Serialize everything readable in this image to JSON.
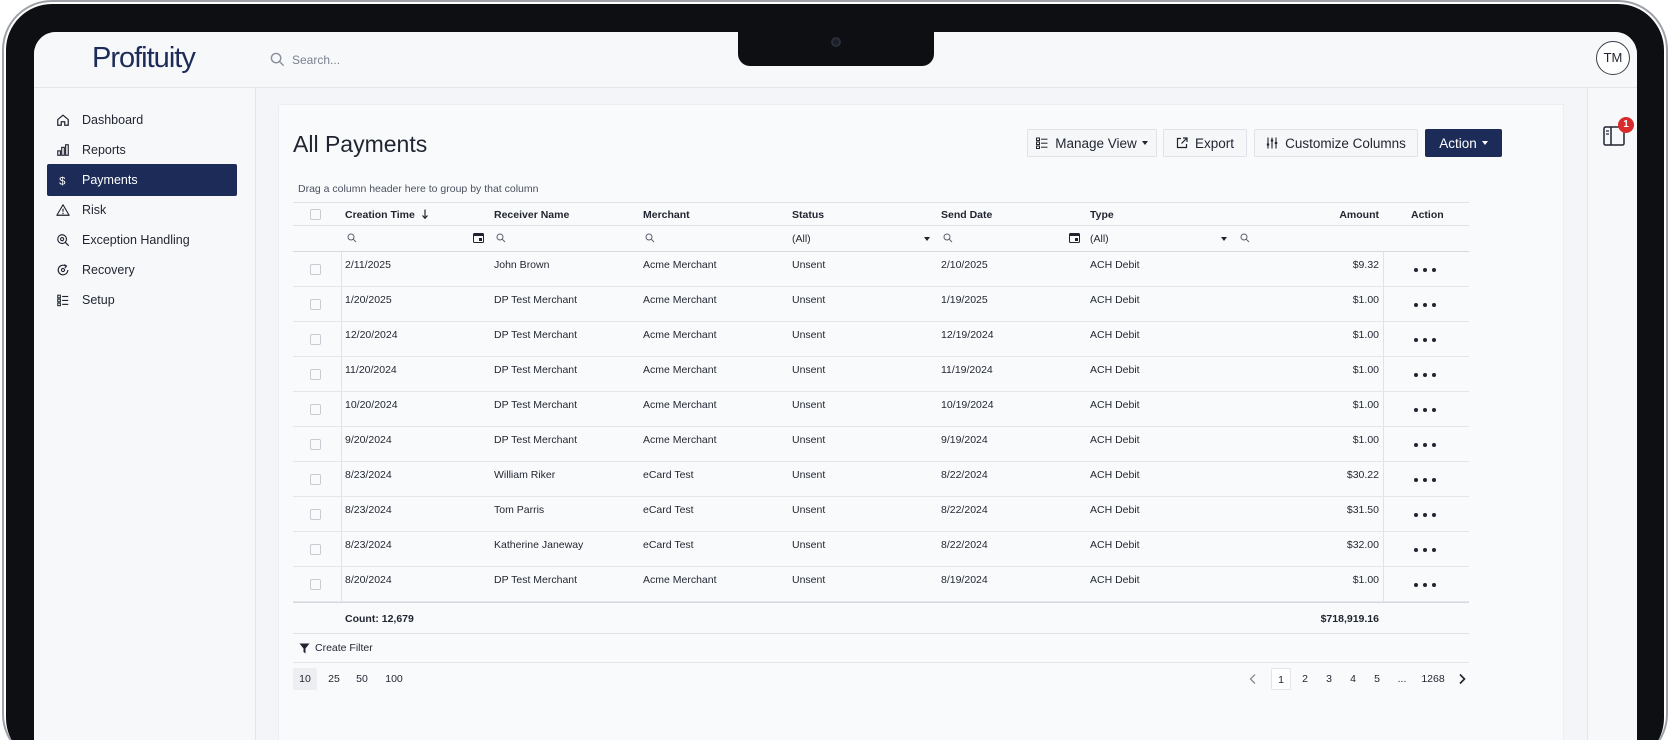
{
  "app": {
    "logo": "Profituity"
  },
  "search": {
    "placeholder": "Search..."
  },
  "user": {
    "initials": "TM"
  },
  "notifications": {
    "count": "1"
  },
  "colors": {
    "brand": "#1d2b59",
    "badge": "#d92b2b"
  },
  "sidebar": {
    "items": [
      {
        "label": "Dashboard",
        "icon": "home-icon",
        "active": false
      },
      {
        "label": "Reports",
        "icon": "bar-chart-icon",
        "active": false
      },
      {
        "label": "Payments",
        "icon": "dollar-icon",
        "active": true
      },
      {
        "label": "Risk",
        "icon": "warning-icon",
        "active": false
      },
      {
        "label": "Exception Handling",
        "icon": "search-gear-icon",
        "active": false
      },
      {
        "label": "Recovery",
        "icon": "recovery-icon",
        "active": false
      },
      {
        "label": "Setup",
        "icon": "list-settings-icon",
        "active": false
      }
    ]
  },
  "page": {
    "title": "All Payments",
    "group_hint": "Drag a column header here to group by that column"
  },
  "toolbar": {
    "manage_view": "Manage View",
    "export": "Export",
    "customize_columns": "Customize Columns",
    "action": "Action"
  },
  "grid": {
    "columns": {
      "creation_time": "Creation Time",
      "receiver_name": "Receiver Name",
      "merchant": "Merchant",
      "status": "Status",
      "send_date": "Send Date",
      "type": "Type",
      "amount": "Amount",
      "action": "Action"
    },
    "filters": {
      "status": "(All)",
      "type": "(All)"
    },
    "rows": [
      {
        "creation_time": "2/11/2025",
        "receiver_name": "John Brown",
        "merchant": "Acme Merchant",
        "status": "Unsent",
        "send_date": "2/10/2025",
        "type": "ACH Debit",
        "amount": "$9.32"
      },
      {
        "creation_time": "1/20/2025",
        "receiver_name": "DP Test Merchant",
        "merchant": "Acme Merchant",
        "status": "Unsent",
        "send_date": "1/19/2025",
        "type": "ACH Debit",
        "amount": "$1.00"
      },
      {
        "creation_time": "12/20/2024",
        "receiver_name": "DP Test Merchant",
        "merchant": "Acme Merchant",
        "status": "Unsent",
        "send_date": "12/19/2024",
        "type": "ACH Debit",
        "amount": "$1.00"
      },
      {
        "creation_time": "11/20/2024",
        "receiver_name": "DP Test Merchant",
        "merchant": "Acme Merchant",
        "status": "Unsent",
        "send_date": "11/19/2024",
        "type": "ACH Debit",
        "amount": "$1.00"
      },
      {
        "creation_time": "10/20/2024",
        "receiver_name": "DP Test Merchant",
        "merchant": "Acme Merchant",
        "status": "Unsent",
        "send_date": "10/19/2024",
        "type": "ACH Debit",
        "amount": "$1.00"
      },
      {
        "creation_time": "9/20/2024",
        "receiver_name": "DP Test Merchant",
        "merchant": "Acme Merchant",
        "status": "Unsent",
        "send_date": "9/19/2024",
        "type": "ACH Debit",
        "amount": "$1.00"
      },
      {
        "creation_time": "8/23/2024",
        "receiver_name": "William Riker",
        "merchant": "eCard Test",
        "status": "Unsent",
        "send_date": "8/22/2024",
        "type": "ACH Debit",
        "amount": "$30.22"
      },
      {
        "creation_time": "8/23/2024",
        "receiver_name": "Tom Parris",
        "merchant": "eCard Test",
        "status": "Unsent",
        "send_date": "8/22/2024",
        "type": "ACH Debit",
        "amount": "$31.50"
      },
      {
        "creation_time": "8/23/2024",
        "receiver_name": "Katherine Janeway",
        "merchant": "eCard Test",
        "status": "Unsent",
        "send_date": "8/22/2024",
        "type": "ACH Debit",
        "amount": "$32.00"
      },
      {
        "creation_time": "8/20/2024",
        "receiver_name": "DP Test Merchant",
        "merchant": "Acme Merchant",
        "status": "Unsent",
        "send_date": "8/19/2024",
        "type": "ACH Debit",
        "amount": "$1.00"
      }
    ],
    "summary": {
      "count": "Count: 12,679",
      "total": "$718,919.16"
    },
    "create_filter": "Create Filter"
  },
  "pager": {
    "sizes": [
      "10",
      "25",
      "50",
      "100"
    ],
    "selected_size": "10",
    "pages": [
      "1",
      "2",
      "3",
      "4",
      "5"
    ],
    "ellipsis": "...",
    "last_page": "1268",
    "current_page": "1"
  }
}
